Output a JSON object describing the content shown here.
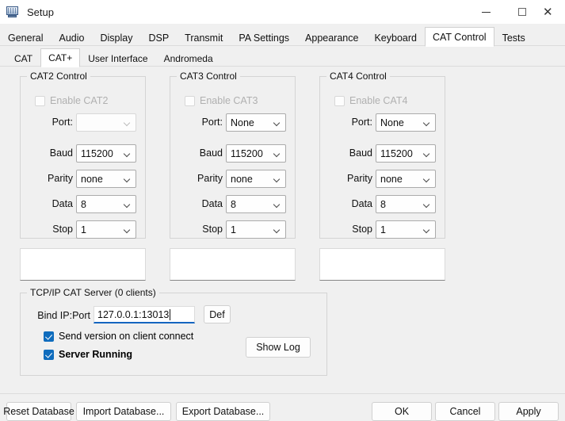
{
  "window": {
    "title": "Setup",
    "icon": "monitor-icon",
    "controls": {
      "minimize": "minimize-icon",
      "maximize": "maximize-icon",
      "close": "close-icon"
    }
  },
  "tabs_primary": {
    "items": [
      {
        "label": "General",
        "selected": false
      },
      {
        "label": "Audio",
        "selected": false
      },
      {
        "label": "Display",
        "selected": false
      },
      {
        "label": "DSP",
        "selected": false
      },
      {
        "label": "Transmit",
        "selected": false
      },
      {
        "label": "PA Settings",
        "selected": false
      },
      {
        "label": "Appearance",
        "selected": false
      },
      {
        "label": "Keyboard",
        "selected": false
      },
      {
        "label": "CAT Control",
        "selected": true
      },
      {
        "label": "Tests",
        "selected": false
      }
    ]
  },
  "tabs_secondary": {
    "items": [
      {
        "label": "CAT",
        "selected": false
      },
      {
        "label": "CAT+",
        "selected": true
      },
      {
        "label": "User Interface",
        "selected": false
      },
      {
        "label": "Andromeda",
        "selected": false
      }
    ]
  },
  "cat_groups": [
    {
      "legend": "CAT2 Control",
      "enable_label": "Enable CAT2",
      "enable_checked": false,
      "enable_disabled": true,
      "fields": [
        {
          "label": "Port:",
          "value": "",
          "disabled": true
        },
        {
          "label": "Baud",
          "value": "115200",
          "disabled": false
        },
        {
          "label": "Parity",
          "value": "none",
          "disabled": false
        },
        {
          "label": "Data",
          "value": "8",
          "disabled": false
        },
        {
          "label": "Stop",
          "value": "1",
          "disabled": false
        }
      ],
      "status_text": ""
    },
    {
      "legend": "CAT3 Control",
      "enable_label": "Enable CAT3",
      "enable_checked": false,
      "enable_disabled": true,
      "fields": [
        {
          "label": "Port:",
          "value": "None",
          "disabled": false
        },
        {
          "label": "Baud",
          "value": "115200",
          "disabled": false
        },
        {
          "label": "Parity",
          "value": "none",
          "disabled": false
        },
        {
          "label": "Data",
          "value": "8",
          "disabled": false
        },
        {
          "label": "Stop",
          "value": "1",
          "disabled": false
        }
      ],
      "status_text": ""
    },
    {
      "legend": "CAT4 Control",
      "enable_label": "Enable CAT4",
      "enable_checked": false,
      "enable_disabled": true,
      "fields": [
        {
          "label": "Port:",
          "value": "None",
          "disabled": false
        },
        {
          "label": "Baud",
          "value": "115200",
          "disabled": false
        },
        {
          "label": "Parity",
          "value": "none",
          "disabled": false
        },
        {
          "label": "Data",
          "value": "8",
          "disabled": false
        },
        {
          "label": "Stop",
          "value": "1",
          "disabled": false
        }
      ],
      "status_text": ""
    }
  ],
  "tcp_server": {
    "legend": "TCP/IP CAT Server (0 clients)",
    "bind_label": "Bind IP:Port",
    "bind_value": "127.0.0.1:13013",
    "def_button": "Def",
    "send_version_label": "Send version on client connect",
    "send_version_checked": true,
    "server_running_label": "Server Running",
    "server_running_checked": true,
    "show_log_button": "Show Log"
  },
  "footer": {
    "left_buttons": [
      "Reset Database",
      "Import Database...",
      "Export Database..."
    ],
    "right_buttons": [
      "OK",
      "Cancel",
      "Apply"
    ]
  },
  "colors": {
    "accent": "#0f6cbd",
    "focus_underline": "#1565c0",
    "window_bg": "#f0f0f0",
    "disabled_text": "#b0b0b0"
  }
}
